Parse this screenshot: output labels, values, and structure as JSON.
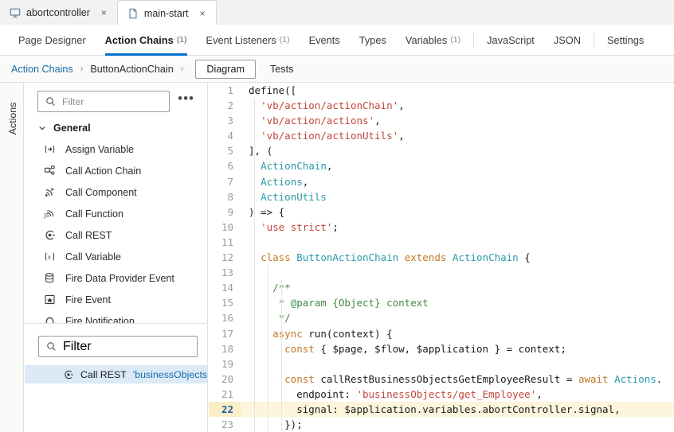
{
  "window_tabs": [
    {
      "label": "abortcontroller",
      "icon": "monitor-icon",
      "close": "×",
      "active": false
    },
    {
      "label": "main-start",
      "icon": "file-icon",
      "close": "×",
      "active": true
    }
  ],
  "subnav": {
    "items": [
      {
        "label": "Page Designer",
        "count": "",
        "active": false,
        "divider_after": false
      },
      {
        "label": "Action Chains",
        "count": "(1)",
        "active": true,
        "divider_after": false
      },
      {
        "label": "Event Listeners",
        "count": "(1)",
        "active": false,
        "divider_after": false
      },
      {
        "label": "Events",
        "count": "",
        "active": false,
        "divider_after": false
      },
      {
        "label": "Types",
        "count": "",
        "active": false,
        "divider_after": false
      },
      {
        "label": "Variables",
        "count": "(1)",
        "active": false,
        "divider_after": true
      },
      {
        "label": "JavaScript",
        "count": "",
        "active": false,
        "divider_after": false
      },
      {
        "label": "JSON",
        "count": "",
        "active": false,
        "divider_after": true
      },
      {
        "label": "Settings",
        "count": "",
        "active": false,
        "divider_after": false
      }
    ]
  },
  "breadcrumb": {
    "root": "Action Chains",
    "sep": "›",
    "chain": "ButtonActionChain",
    "view_button": "Diagram",
    "view_alt": "Tests"
  },
  "rail": {
    "label": "Actions"
  },
  "palette": {
    "filter_placeholder": "Filter",
    "filter_value": "",
    "overflow": "•••",
    "group": {
      "label": "General",
      "chevron": "⌄"
    },
    "items": [
      {
        "label": "Assign Variable",
        "icon": "assign-variable-icon"
      },
      {
        "label": "Call Action Chain",
        "icon": "call-action-chain-icon"
      },
      {
        "label": "Call Component",
        "icon": "call-component-icon"
      },
      {
        "label": "Call Function",
        "icon": "call-function-icon"
      },
      {
        "label": "Call REST",
        "icon": "call-rest-icon"
      },
      {
        "label": "Call Variable",
        "icon": "call-variable-icon"
      },
      {
        "label": "Fire Data Provider Event",
        "icon": "fire-data-provider-event-icon"
      },
      {
        "label": "Fire Event",
        "icon": "fire-event-icon"
      },
      {
        "label": "Fire Notification",
        "icon": "fire-notification-icon"
      }
    ]
  },
  "chain_pane": {
    "filter_placeholder": "Filter",
    "filter_value": "",
    "selected_row": {
      "icon": "call-rest-icon",
      "label": "Call REST",
      "argument": "'businessObjects/g"
    }
  },
  "editor": {
    "highlighted_line": 22,
    "lines": [
      {
        "n": 1,
        "tokens": [
          {
            "t": "def",
            "v": "define(["
          }
        ]
      },
      {
        "n": 2,
        "tokens": [
          {
            "t": "pun",
            "v": "  "
          },
          {
            "t": "str",
            "v": "'vb/action/actionChain'"
          },
          {
            "t": "pun",
            "v": ","
          }
        ]
      },
      {
        "n": 3,
        "tokens": [
          {
            "t": "pun",
            "v": "  "
          },
          {
            "t": "str",
            "v": "'vb/action/actions'"
          },
          {
            "t": "pun",
            "v": ","
          }
        ]
      },
      {
        "n": 4,
        "tokens": [
          {
            "t": "pun",
            "v": "  "
          },
          {
            "t": "str",
            "v": "'vb/action/actionUtils'"
          },
          {
            "t": "pun",
            "v": ","
          }
        ]
      },
      {
        "n": 5,
        "tokens": [
          {
            "t": "pun",
            "v": "], ("
          }
        ]
      },
      {
        "n": 6,
        "tokens": [
          {
            "t": "pun",
            "v": "  "
          },
          {
            "t": "cls",
            "v": "ActionChain"
          },
          {
            "t": "pun",
            "v": ","
          }
        ]
      },
      {
        "n": 7,
        "tokens": [
          {
            "t": "pun",
            "v": "  "
          },
          {
            "t": "cls",
            "v": "Actions"
          },
          {
            "t": "pun",
            "v": ","
          }
        ]
      },
      {
        "n": 8,
        "tokens": [
          {
            "t": "pun",
            "v": "  "
          },
          {
            "t": "cls",
            "v": "ActionUtils"
          }
        ]
      },
      {
        "n": 9,
        "tokens": [
          {
            "t": "pun",
            "v": ") => {"
          }
        ]
      },
      {
        "n": 10,
        "tokens": [
          {
            "t": "pun",
            "v": "  "
          },
          {
            "t": "str",
            "v": "'use strict'"
          },
          {
            "t": "pun",
            "v": ";"
          }
        ]
      },
      {
        "n": 11,
        "tokens": [
          {
            "t": "pun",
            "v": ""
          }
        ]
      },
      {
        "n": 12,
        "tokens": [
          {
            "t": "pun",
            "v": "  "
          },
          {
            "t": "kw",
            "v": "class"
          },
          {
            "t": "pun",
            "v": " "
          },
          {
            "t": "cls",
            "v": "ButtonActionChain"
          },
          {
            "t": "pun",
            "v": " "
          },
          {
            "t": "kw",
            "v": "extends"
          },
          {
            "t": "pun",
            "v": " "
          },
          {
            "t": "cls",
            "v": "ActionChain"
          },
          {
            "t": "pun",
            "v": " {"
          }
        ]
      },
      {
        "n": 13,
        "tokens": [
          {
            "t": "pun",
            "v": ""
          }
        ]
      },
      {
        "n": 14,
        "tokens": [
          {
            "t": "com",
            "v": "    /**"
          }
        ]
      },
      {
        "n": 15,
        "tokens": [
          {
            "t": "com",
            "v": "     * @param {Object} context"
          }
        ]
      },
      {
        "n": 16,
        "tokens": [
          {
            "t": "com",
            "v": "     */"
          }
        ]
      },
      {
        "n": 17,
        "tokens": [
          {
            "t": "pun",
            "v": "    "
          },
          {
            "t": "kw",
            "v": "async"
          },
          {
            "t": "pun",
            "v": " run(context) {"
          }
        ]
      },
      {
        "n": 18,
        "tokens": [
          {
            "t": "pun",
            "v": "      "
          },
          {
            "t": "kw",
            "v": "const"
          },
          {
            "t": "pun",
            "v": " { $page, $flow, $application } = context;"
          }
        ]
      },
      {
        "n": 19,
        "tokens": [
          {
            "t": "pun",
            "v": ""
          }
        ]
      },
      {
        "n": 20,
        "tokens": [
          {
            "t": "pun",
            "v": "      "
          },
          {
            "t": "kw",
            "v": "const"
          },
          {
            "t": "pun",
            "v": " callRestBusinessObjectsGetEmployeeResult = "
          },
          {
            "t": "kw",
            "v": "await"
          },
          {
            "t": "pun",
            "v": " "
          },
          {
            "t": "cls",
            "v": "Actions"
          },
          {
            "t": "pun",
            "v": "."
          }
        ]
      },
      {
        "n": 21,
        "tokens": [
          {
            "t": "pun",
            "v": "        endpoint: "
          },
          {
            "t": "str",
            "v": "'businessObjects/get_Employee'"
          },
          {
            "t": "pun",
            "v": ","
          }
        ]
      },
      {
        "n": 22,
        "tokens": [
          {
            "t": "pun",
            "v": "        signal: $application.variables.abortController.signal,"
          }
        ]
      },
      {
        "n": 23,
        "tokens": [
          {
            "t": "pun",
            "v": "      });"
          }
        ]
      }
    ]
  },
  "colors": {
    "accent": "#0572ce",
    "link": "#1a6ea8",
    "selection": "#dceaf7",
    "line_highlight": "#fdf6dd",
    "string": "#c2463b",
    "keyword": "#c07a1f",
    "class": "#2a9aa8",
    "comment": "#3f8a3f"
  }
}
